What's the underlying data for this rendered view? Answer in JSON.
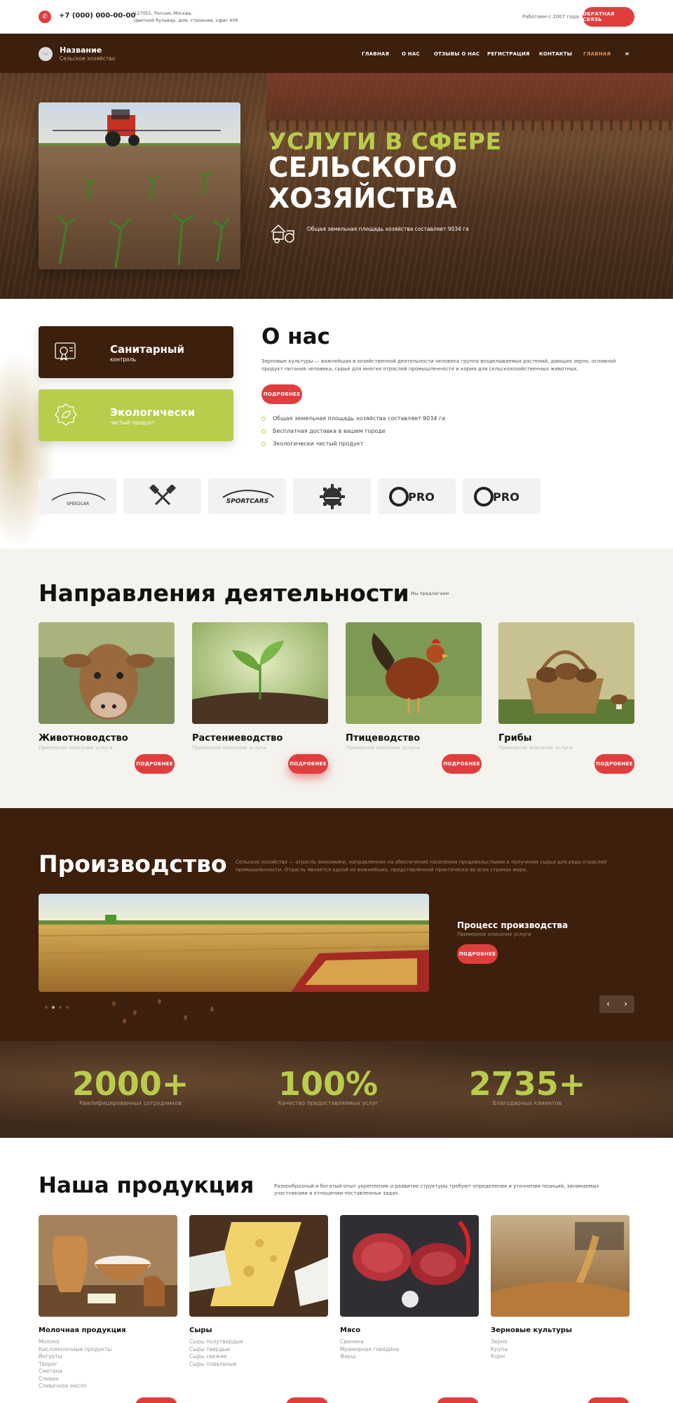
{
  "topbar": {
    "phone": "+7 (000) 000-00-00",
    "address_line1": "127051, Россия, Москва,",
    "address_line2": "Цветной бульвар, дом, строение, офис 406",
    "since": "Работаем с 2007 года",
    "callback": "ОБРАТНАЯ СВЯЗЬ"
  },
  "header": {
    "logo_name": "Название",
    "logo_sub": "Сельское хозяйство",
    "nav": [
      "ГЛАВНАЯ",
      "О НАС",
      "ОТЗЫВЫ О НАС",
      "РЕГИСТРАЦИЯ",
      "КОНТАКТЫ",
      "ГЛАВНАЯ"
    ]
  },
  "hero": {
    "title_line1": "УСЛУГИ В СФЕРЕ",
    "title_line2": "СЕЛЬСКОГО",
    "title_line3": "ХОЗЯЙСТВА",
    "area_text": "Общая земельная площадь хозяйства составляет 9034 га"
  },
  "features": [
    {
      "title": "Санитарный",
      "sub": "контроль",
      "icon": "certificate-icon"
    },
    {
      "title": "Экологически",
      "sub": "чистый продукт",
      "icon": "eco-badge-icon"
    }
  ],
  "about": {
    "title": "О нас",
    "text": "Зерновые культуры — важнейшая в хозяйственной деятельности человека группа возделываемых растений, дающих зерно, основной продукт питания человека, сырьё для многих отраслей промышленности и корма для сельскохозяйственных животных.",
    "more": "ПОДРОБНЕЕ",
    "bullets": [
      "Общая земельная площадь хозяйства составляет 9034 га",
      "Бесплатная доставка в вашем городе",
      "Экологически чистый продукт"
    ]
  },
  "brands": [
    "SPEEDCAR",
    "pistons-logo",
    "SPORTCARS",
    "gear-logo",
    "PRO",
    "PRO"
  ],
  "directions": {
    "title": "Направления деятельности",
    "offer": "Мы предлагаем",
    "cards": [
      {
        "title": "Животноводство",
        "sub": "Примерное описание услуги",
        "more": "ПОДРОБНЕЕ"
      },
      {
        "title": "Растениеводство",
        "sub": "Примерное описание услуги",
        "more": "ПОДРОБНЕЕ"
      },
      {
        "title": "Птицеводство",
        "sub": "Примерное описание услуги",
        "more": "ПОДРОБНЕЕ"
      },
      {
        "title": "Грибы",
        "sub": "Примерное описание услуги",
        "more": "ПОДРОБНЕЕ"
      }
    ]
  },
  "production": {
    "title": "Производство",
    "text": "Сельское хозяйство — отрасль экономики, направленная на обеспечение населения продовольствием и получение сырья для ряда отраслей промышленности. Отрасль является одной из важнейших, представленной практически во всех странах мира.",
    "process_title": "Процесс производства",
    "process_sub": "Примерное описание услуги",
    "more": "ПОДРОБНЕЕ",
    "prev": "‹",
    "next": "›"
  },
  "stats": [
    {
      "value": "2000+",
      "label": "Квалифицированных сотрудников"
    },
    {
      "value": "100%",
      "label": "Качество предоставляемых услуг"
    },
    {
      "value": "2735+",
      "label": "Благодарных клиентов"
    }
  ],
  "products": {
    "title": "Наша продукция",
    "text": "Разнообразный и богатый опыт укрепление и развитие структуры требуют определения и уточнения позиций, занимаемых участниками в отношении поставленных задач.",
    "cards": [
      {
        "title": "Молочная продукция",
        "items": [
          "Молоко",
          "Кисломолочные продукты",
          "Йогурты",
          "Творог",
          "Сметана",
          "Сливки",
          "Сливочное масло"
        ]
      },
      {
        "title": "Сыры",
        "items": [
          "Сыры полутвердые",
          "Сыры твердые",
          "Сыры свежие",
          "Сыры плавленые"
        ]
      },
      {
        "title": "Мясо",
        "items": [
          "Свинина",
          "Мраморная говядина",
          "Фарш"
        ]
      },
      {
        "title": "Зерновые культуры",
        "items": [
          "Зерно",
          "Крупа",
          "Корм"
        ]
      }
    ]
  },
  "colors": {
    "brown": "#3d1f0d",
    "green": "#b9cc4c",
    "red": "#e03e3e"
  }
}
